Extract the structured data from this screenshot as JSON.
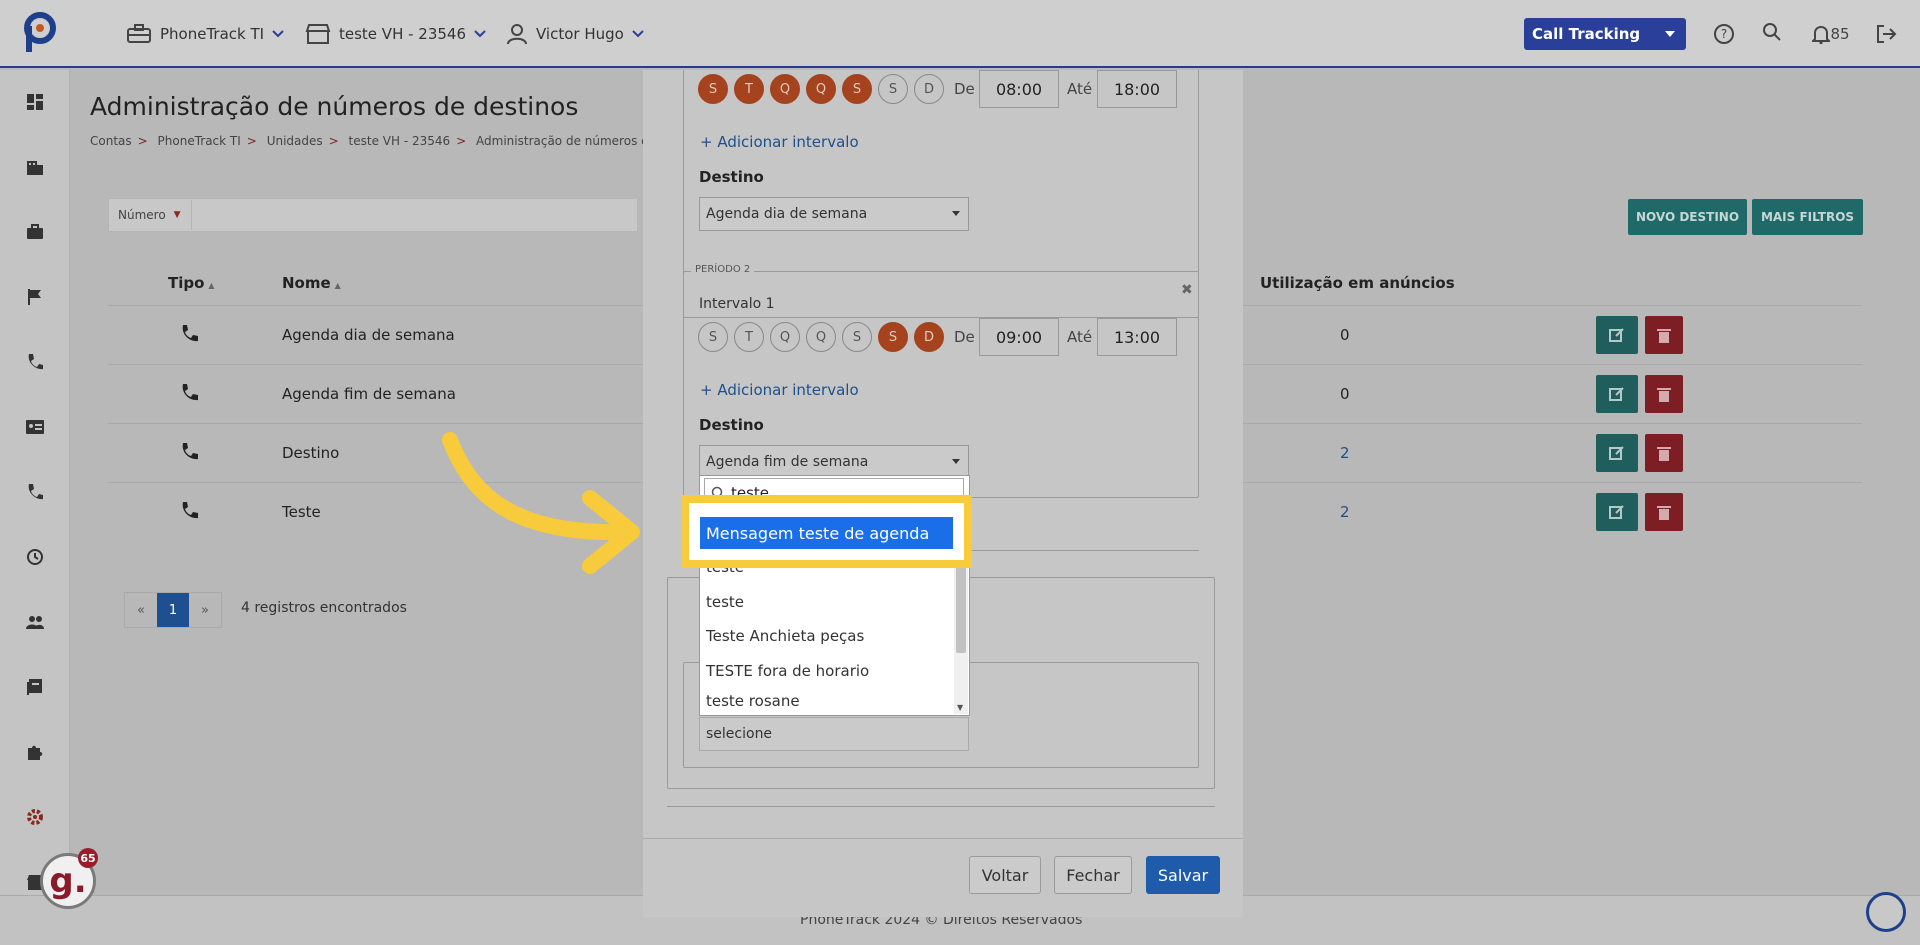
{
  "topbar": {
    "account": "PhoneTrack TI",
    "unit": "teste VH - 23546",
    "user": "Victor Hugo",
    "product": "Call Tracking",
    "notifications": "85"
  },
  "page": {
    "title": "Administração de números de destinos",
    "breadcrumb": [
      "Contas",
      "PhoneTrack TI",
      "Unidades",
      "teste VH - 23546",
      "Administração de números de"
    ]
  },
  "filter": {
    "label": "Número"
  },
  "buttons": {
    "new": "NOVO DESTINO",
    "more_filters": "MAIS FILTROS"
  },
  "table": {
    "headers": {
      "type": "Tipo",
      "name": "Nome",
      "usage": "Utilização em anúncios"
    },
    "rows": [
      {
        "name": "Agenda dia de semana",
        "usage": "0"
      },
      {
        "name": "Agenda fim de semana",
        "usage": "0"
      },
      {
        "name": "Destino",
        "usage": "2"
      },
      {
        "name": "Teste",
        "usage": "2"
      }
    ]
  },
  "pagination": {
    "prev": "«",
    "current": "1",
    "next": "»",
    "records": "4 registros encontrados"
  },
  "footer": "PhoneTrack 2024 © Direitos Reservados",
  "modal": {
    "period1": {
      "days": [
        "S",
        "T",
        "Q",
        "Q",
        "S",
        "S",
        "D"
      ],
      "from_label": "De",
      "from": "08:00",
      "to_label": "Até",
      "to": "18:00",
      "add_interval": "Adicionar intervalo",
      "dest_label": "Destino",
      "dest_value": "Agenda dia de semana"
    },
    "period2": {
      "legend": "PERÍODO 2",
      "interval_label": "Intervalo 1",
      "days": [
        "S",
        "T",
        "Q",
        "Q",
        "S",
        "S",
        "D"
      ],
      "from_label": "De",
      "from": "09:00",
      "to_label": "Até",
      "to": "13:00",
      "add_interval": "Adicionar intervalo",
      "dest_label": "Destino",
      "dest_value": "Agenda fim de semana"
    },
    "lower_select": "selecione",
    "btn_back": "Voltar",
    "btn_close": "Fechar",
    "btn_save": "Salvar"
  },
  "dropdown": {
    "search": "teste",
    "highlighted": "Mensagem teste de agenda",
    "items": [
      "teste",
      "teste",
      "Teste Anchieta peças",
      "TESTE fora de horario",
      "teste rosane"
    ]
  },
  "badge": {
    "letter": "g.",
    "count": "65"
  },
  "colors": {
    "accent": "#f7cb3b",
    "selected": "#1a6fe8",
    "day_active": "#a4431e"
  }
}
